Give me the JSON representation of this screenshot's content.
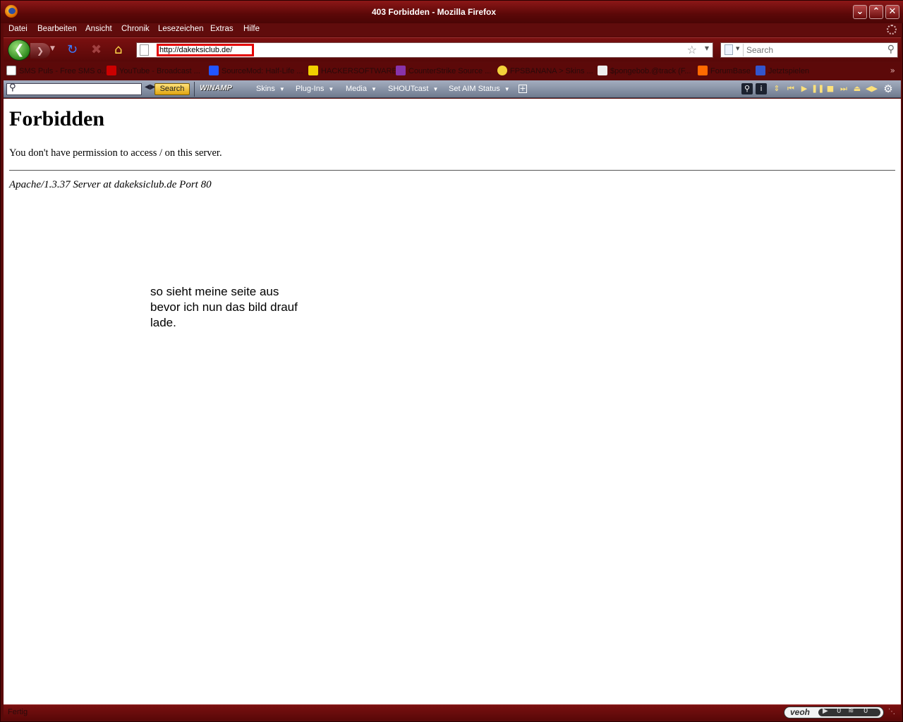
{
  "window": {
    "title": "403 Forbidden - Mozilla Firefox"
  },
  "menu": {
    "items": [
      "Datei",
      "Bearbeiten",
      "Ansicht",
      "Chronik",
      "Lesezeichen",
      "Extras",
      "Hilfe"
    ]
  },
  "nav": {
    "url": "http://dakeksiclub.de/",
    "search_placeholder": "Search"
  },
  "bookmarks": [
    {
      "label": "SMS Puls - Free SMS o...",
      "color": "#ffffff"
    },
    {
      "label": "YouTube - Broadcast ...",
      "color": "#cc0000"
    },
    {
      "label": "SourceMod: Half-Life ...",
      "color": "#2255ff"
    },
    {
      "label": "HACKERSOFTWARE",
      "color": "#f0d000"
    },
    {
      "label": "CounterStrike Source ...",
      "color": "#8833aa"
    },
    {
      "label": "FPSBANANA > Skins ...",
      "color": "#f3d23a"
    },
    {
      "label": "$pongebob.@track (F...",
      "color": "#eeeeee"
    },
    {
      "label": "ForumBase",
      "color": "#ff6a00"
    },
    {
      "label": "Jetztspielen",
      "color": "#3355cc"
    }
  ],
  "winamp": {
    "search_button": "Search",
    "logo": "WINAMP",
    "menus": [
      "Skins",
      "Plug-Ins",
      "Media",
      "SHOUTcast",
      "Set AIM Status"
    ]
  },
  "page": {
    "heading": "Forbidden",
    "message": "You don't have permission to access / on this server.",
    "server_line": "Apache/1.3.37 Server at dakeksiclub.de Port 80",
    "note_lines": [
      "so sieht meine seite aus",
      "bevor ich nun das bild drauf",
      "lade."
    ]
  },
  "status": {
    "text": "Fertig",
    "veoh_logo": "veoh",
    "veoh_count_1": "0",
    "veoh_count_2": "0"
  }
}
